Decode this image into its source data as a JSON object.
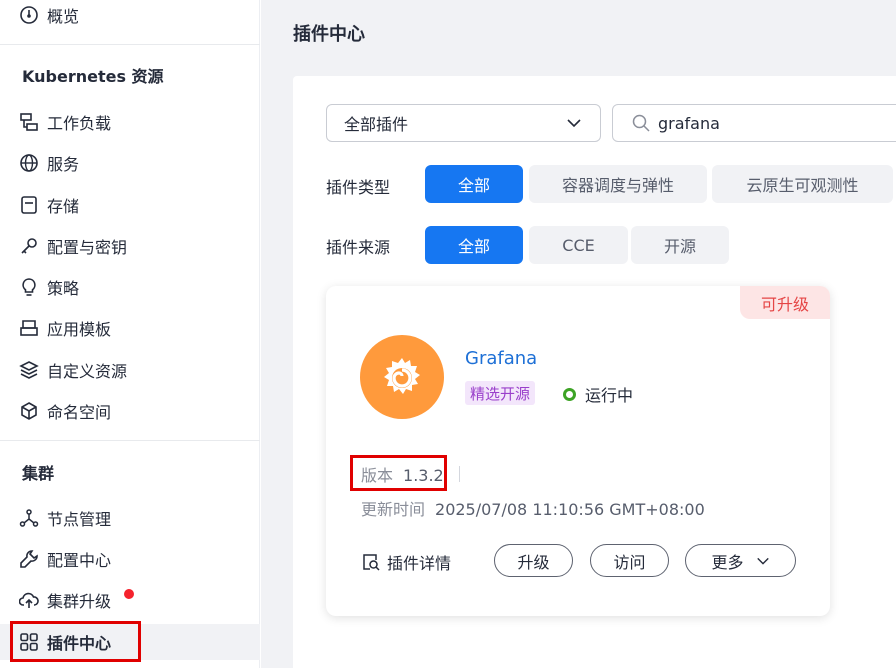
{
  "sidebar": {
    "overview": "概览",
    "k8s_section": "Kubernetes 资源",
    "k8s_items": [
      "工作负载",
      "服务",
      "存储",
      "配置与密钥",
      "策略",
      "应用模板",
      "自定义资源",
      "命名空间"
    ],
    "cluster_section": "集群",
    "cluster_items": [
      "节点管理",
      "配置中心",
      "集群升级",
      "插件中心"
    ]
  },
  "main": {
    "title": "插件中心",
    "category_select": "全部插件",
    "search_value": "grafana",
    "type_label": "插件类型",
    "type_options": [
      "全部",
      "容器调度与弹性",
      "云原生可观测性"
    ],
    "source_label": "插件来源",
    "source_options": [
      "全部",
      "CCE",
      "开源"
    ]
  },
  "card": {
    "badge": "可升级",
    "name": "Grafana",
    "tag": "精选开源",
    "status": "运行中",
    "version_label": "版本",
    "version_value": "1.3.2",
    "updated_label": "更新时间",
    "updated_value": "2025/07/08 11:10:56 GMT+08:00",
    "details_label": "插件详情",
    "upgrade_btn": "升级",
    "visit_btn": "访问",
    "more_btn": "更多"
  },
  "colors": {
    "primary": "#1677f2",
    "highlight": "#e00000",
    "status_running": "#3da325",
    "logo_orange": "#ff9a3c"
  }
}
